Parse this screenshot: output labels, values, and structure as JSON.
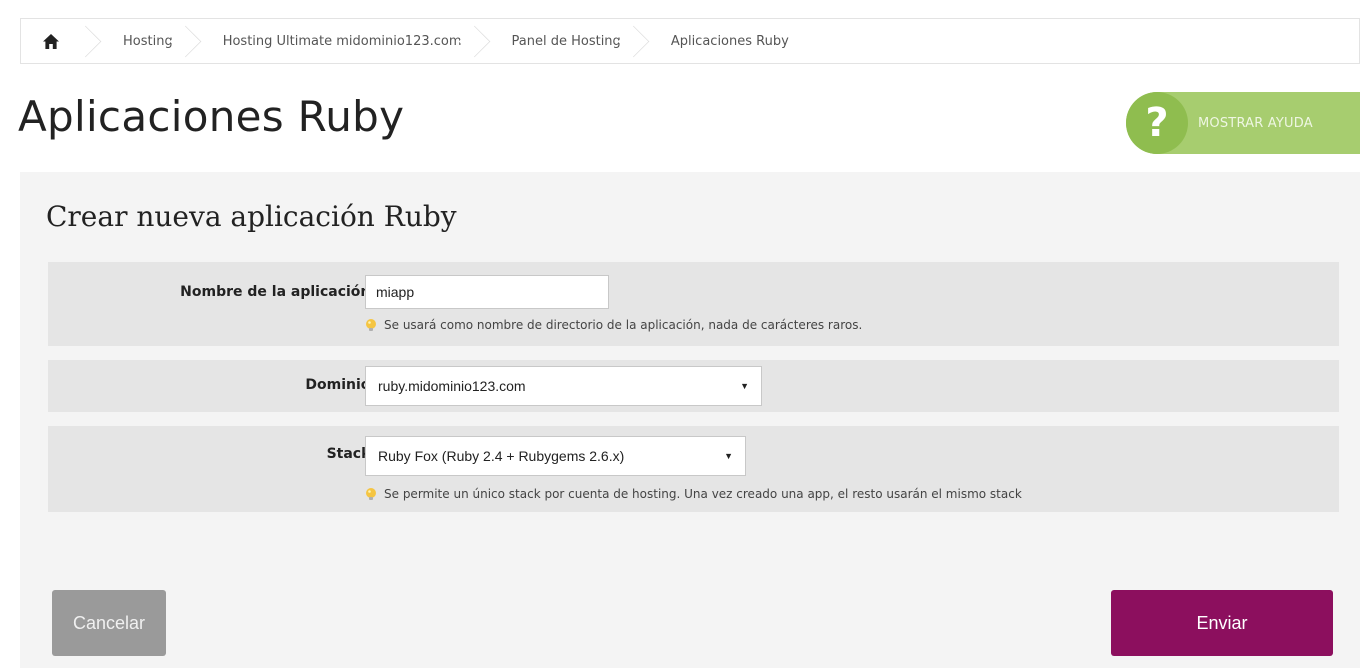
{
  "breadcrumb": {
    "home_icon": "home-icon",
    "items": [
      {
        "label": "Hosting"
      },
      {
        "label": "Hosting Ultimate midominio123.com"
      },
      {
        "label": "Panel de Hosting"
      },
      {
        "label": "Aplicaciones Ruby"
      }
    ]
  },
  "page": {
    "title": "Aplicaciones Ruby"
  },
  "help": {
    "icon": "question-icon",
    "glyph": "?",
    "label": "MOSTRAR AYUDA",
    "color": "#a7cd6f"
  },
  "form": {
    "title": "Crear nueva aplicación Ruby",
    "name_field": {
      "label": "Nombre de la aplicación:",
      "value": "miapp",
      "hint": "Se usará como nombre de directorio de la aplicación, nada de carácteres raros."
    },
    "domain_field": {
      "label": "Dominio:",
      "selected": "ruby.midominio123.com"
    },
    "stack_field": {
      "label": "Stack:",
      "selected": "Ruby Fox (Ruby 2.4 + Rubygems 2.6.x)",
      "hint": "Se permite un único stack por cuenta de hosting. Una vez creado una app, el resto usarán el mismo stack"
    },
    "hint_icon": "lightbulb-icon",
    "select_arrow": "▼"
  },
  "actions": {
    "cancel_label": "Cancelar",
    "submit_label": "Enviar",
    "submit_color": "#8c0f5e",
    "cancel_color": "#9a9a9a"
  }
}
